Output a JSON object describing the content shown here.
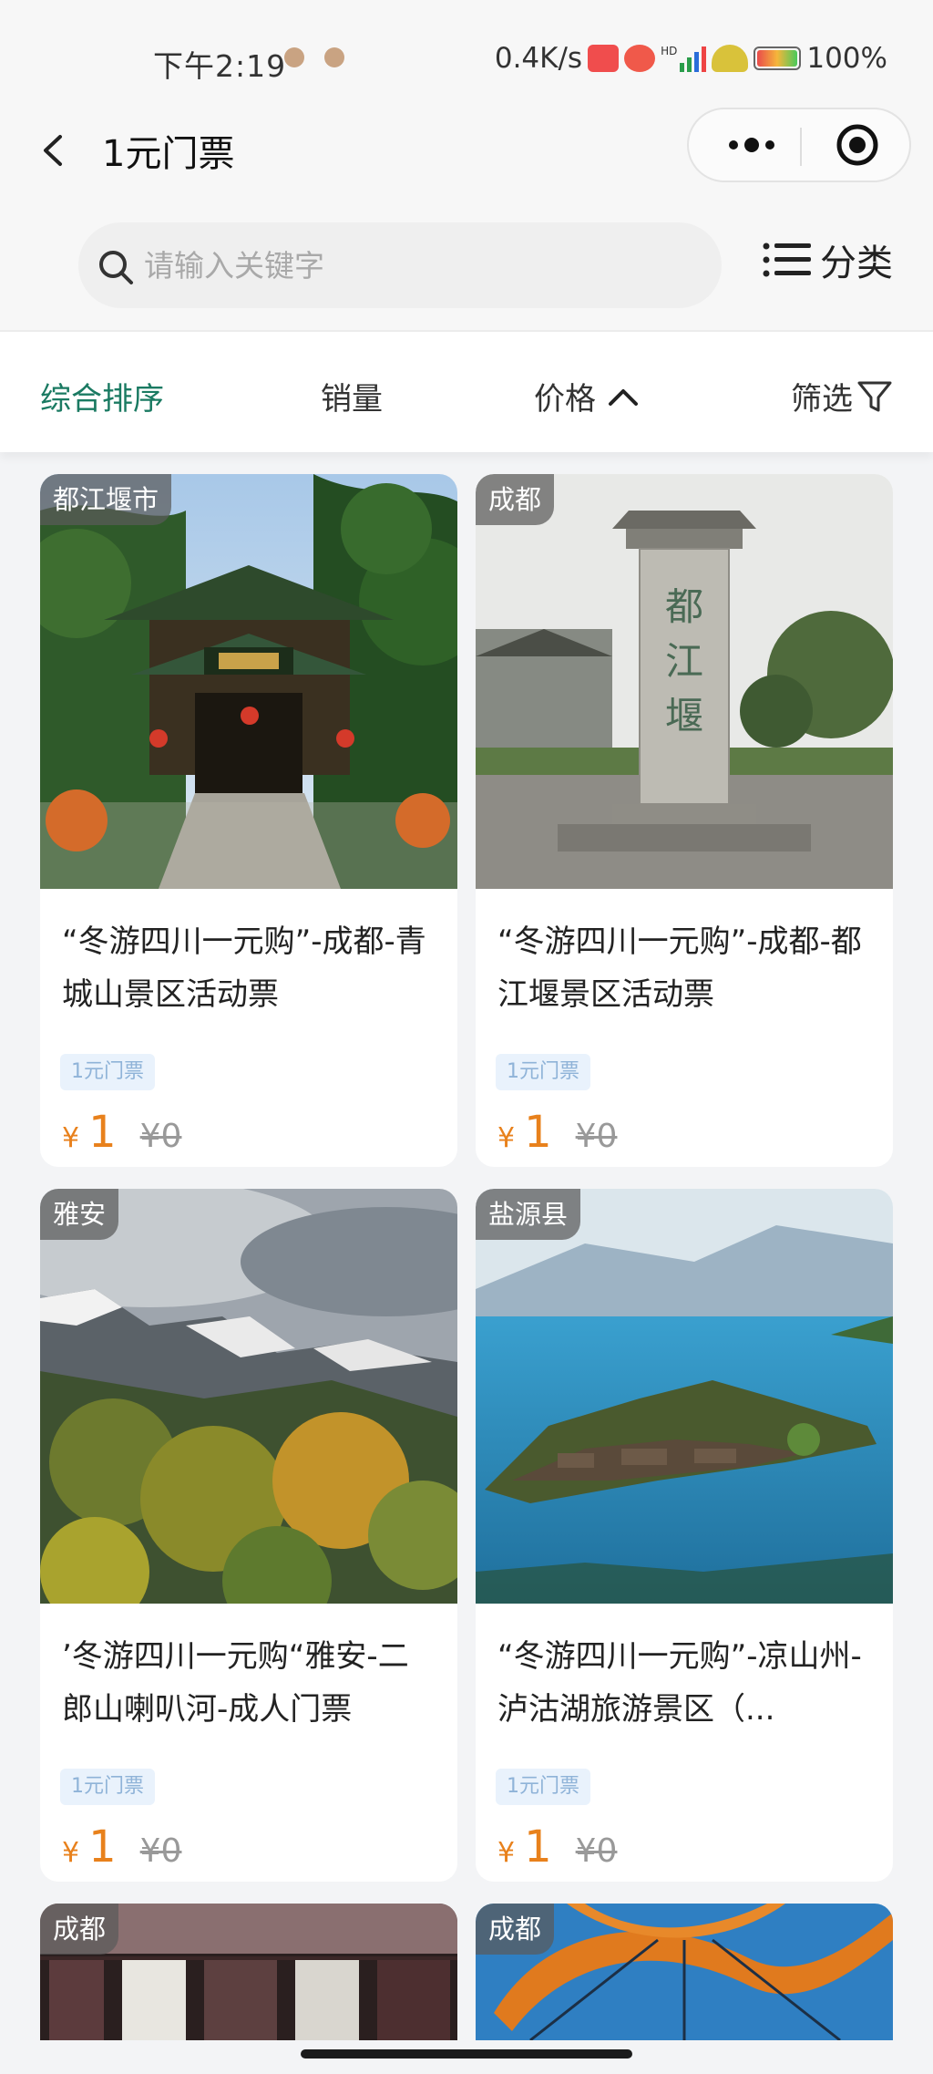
{
  "status_bar": {
    "time": "下午2:19",
    "network_speed": "0.4K/s",
    "hd_label": "HD",
    "battery": "100%"
  },
  "nav": {
    "title": "1元门票"
  },
  "search": {
    "placeholder": "请输入关键字",
    "category_label": "分类"
  },
  "sort_tabs": [
    {
      "label": "综合排序",
      "active": true
    },
    {
      "label": "销量",
      "active": false
    },
    {
      "label": "价格",
      "active": false
    },
    {
      "label": "筛选",
      "active": false
    }
  ],
  "products": [
    {
      "location": "都江堰市",
      "title": "“冬游四川一元购”-成都-青城山景区活动票",
      "tag": "1元门票",
      "currency": "¥",
      "price": "1",
      "original_price": "¥0",
      "image": "temple-gate"
    },
    {
      "location": "成都",
      "title": "“冬游四川一元购”-成都-都江堰景区活动票",
      "tag": "1元门票",
      "currency": "¥",
      "price": "1",
      "original_price": "¥0",
      "image": "stone-monument"
    },
    {
      "location": "雅安",
      "title": "’冬游四川一元购“雅安-二郎山喇叭河-成人门票",
      "tag": "1元门票",
      "currency": "¥",
      "price": "1",
      "original_price": "¥0",
      "image": "snow-mountain-forest"
    },
    {
      "location": "盐源县",
      "title": "“冬游四川一元购”-凉山州-泸沽湖旅游景区（...",
      "tag": "1元门票",
      "currency": "¥",
      "price": "1",
      "original_price": "¥0",
      "image": "lake-island"
    },
    {
      "location": "成都",
      "title": "",
      "tag": "",
      "currency": "",
      "price": "",
      "original_price": "",
      "image": "dark-interior"
    },
    {
      "location": "成都",
      "title": "",
      "tag": "",
      "currency": "",
      "price": "",
      "original_price": "",
      "image": "orange-sculpture"
    }
  ],
  "colors": {
    "accent_green": "#1a7a62",
    "price_orange": "#e8811c",
    "tag_bg": "#e9f2fc",
    "tag_text": "#8fb3d8"
  }
}
